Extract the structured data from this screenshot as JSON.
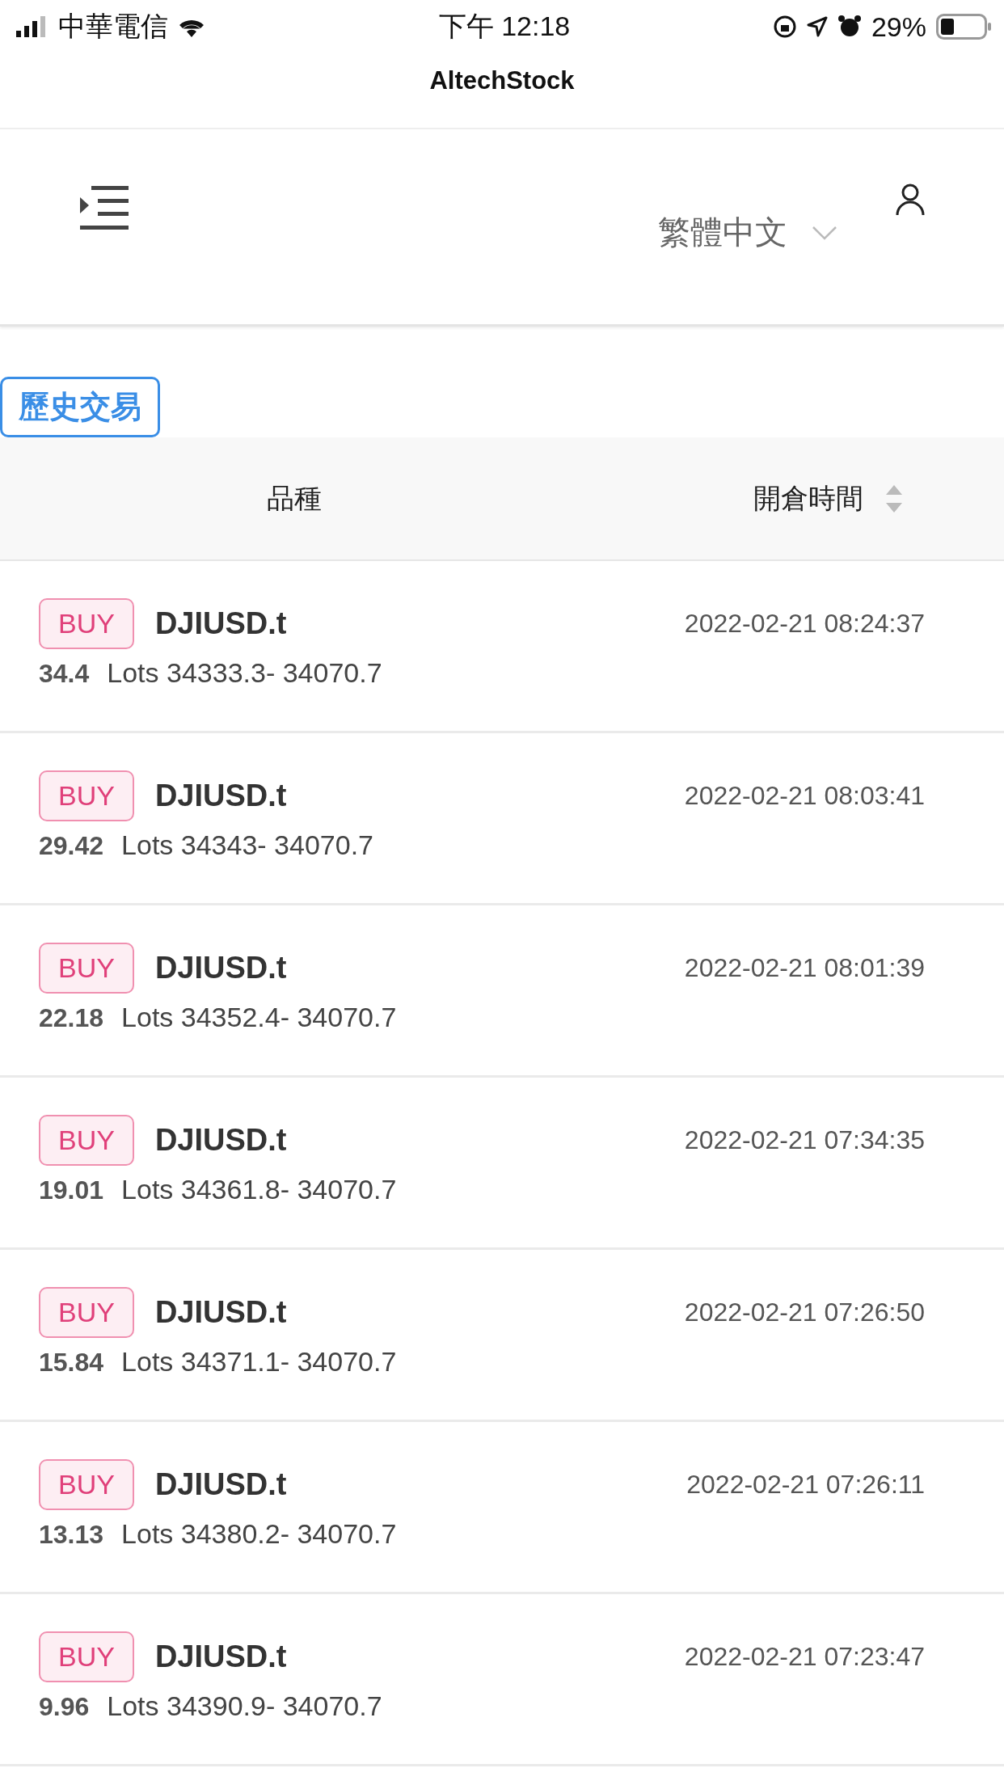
{
  "status_bar": {
    "carrier": "中華電信",
    "time": "下午 12:18",
    "battery": "29%"
  },
  "app_title": "AltechStock",
  "header": {
    "language": "繁體中文"
  },
  "section_label": "歷史交易",
  "table": {
    "columns": [
      {
        "label": "品種"
      },
      {
        "label": "開倉時間",
        "sortable": true
      }
    ],
    "rows": [
      {
        "side": "BUY",
        "symbol": "DJIUSD.t",
        "volume": "34.4",
        "detail": "Lots 34333.3- 34070.7",
        "open_time": "2022-02-21 08:24:37"
      },
      {
        "side": "BUY",
        "symbol": "DJIUSD.t",
        "volume": "29.42",
        "detail": "Lots 34343- 34070.7",
        "open_time": "2022-02-21 08:03:41"
      },
      {
        "side": "BUY",
        "symbol": "DJIUSD.t",
        "volume": "22.18",
        "detail": "Lots 34352.4- 34070.7",
        "open_time": "2022-02-21 08:01:39"
      },
      {
        "side": "BUY",
        "symbol": "DJIUSD.t",
        "volume": "19.01",
        "detail": "Lots 34361.8- 34070.7",
        "open_time": "2022-02-21 07:34:35"
      },
      {
        "side": "BUY",
        "symbol": "DJIUSD.t",
        "volume": "15.84",
        "detail": "Lots 34371.1- 34070.7",
        "open_time": "2022-02-21 07:26:50"
      },
      {
        "side": "BUY",
        "symbol": "DJIUSD.t",
        "volume": "13.13",
        "detail": "Lots 34380.2- 34070.7",
        "open_time": "2022-02-21 07:26:11"
      },
      {
        "side": "BUY",
        "symbol": "DJIUSD.t",
        "volume": "9.96",
        "detail": "Lots 34390.9- 34070.7",
        "open_time": "2022-02-21 07:23:47"
      }
    ]
  }
}
